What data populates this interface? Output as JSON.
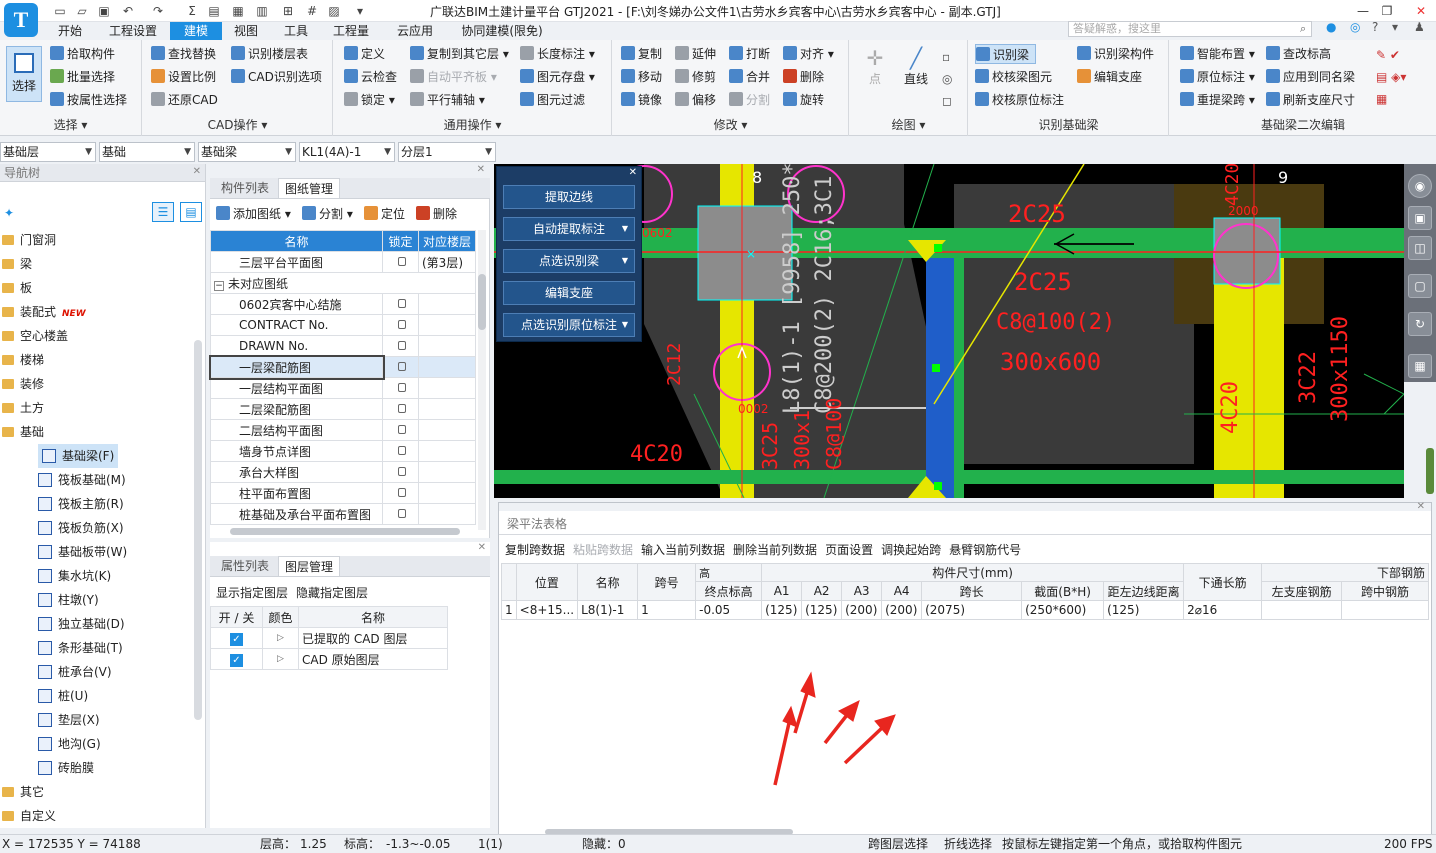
{
  "app": {
    "logo": "T",
    "title": "广联达BIM土建计量平台 GTJ2021 - [F:\\刘冬娣办公文件1\\古劳水乡宾客中心\\古劳水乡宾客中心 - 副本.GTJ]",
    "search_placeholder": "答疑解惑，搜这里"
  },
  "menu": [
    "开始",
    "工程设置",
    "建模",
    "视图",
    "工具",
    "工程量",
    "云应用",
    "协同建模(限免)"
  ],
  "ribbon": {
    "select": {
      "big": "选择",
      "items": [
        "拾取构件",
        "批量选择",
        "按属性选择"
      ],
      "label": "选择"
    },
    "cad": {
      "col1": [
        "查找替换",
        "设置比例",
        "还原CAD"
      ],
      "col2": [
        "识别楼层表",
        "CAD识别选项"
      ],
      "label": "CAD操作"
    },
    "common": {
      "col1": [
        "定义",
        "云检查",
        "锁定"
      ],
      "col2": [
        "复制到其它层",
        "自动平齐板",
        "平行辅轴"
      ],
      "col3": [
        "长度标注",
        "图元存盘",
        "图元过滤"
      ],
      "label": "通用操作"
    },
    "modify": {
      "col1": [
        "复制",
        "移动",
        "镜像"
      ],
      "col2": [
        "延伸",
        "修剪",
        "偏移"
      ],
      "col3": [
        "打断",
        "合并",
        "分割"
      ],
      "col4": [
        "对齐",
        "删除",
        "旋转"
      ],
      "label": "修改"
    },
    "draw": {
      "items": [
        "点",
        "直线"
      ],
      "label": "绘图"
    },
    "recog": {
      "items": [
        "识别梁",
        "校核梁图元",
        "校核原位标注"
      ],
      "col2": [
        "识别梁构件",
        "编辑支座"
      ],
      "label": "识别基础梁"
    },
    "second": {
      "col1": [
        "智能布置",
        "原位标注",
        "重提梁跨"
      ],
      "col2": [
        "查改标高",
        "应用到同名梁",
        "刷新支座尺寸"
      ],
      "label": "基础梁二次编辑"
    }
  },
  "selectors": [
    "基础层",
    "基础",
    "基础梁",
    "KL1(4A)-1",
    "分层1"
  ],
  "nav": {
    "title": "导航树",
    "items": [
      {
        "t": "门窗洞",
        "lvl": 0
      },
      {
        "t": "梁",
        "lvl": 0
      },
      {
        "t": "板",
        "lvl": 0
      },
      {
        "t": "装配式",
        "lvl": 0,
        "badge": "NEW"
      },
      {
        "t": "空心楼盖",
        "lvl": 0
      },
      {
        "t": "楼梯",
        "lvl": 0
      },
      {
        "t": "装修",
        "lvl": 0
      },
      {
        "t": "土方",
        "lvl": 0
      },
      {
        "t": "基础",
        "lvl": 0
      },
      {
        "t": "基础梁(F)",
        "lvl": 1,
        "sel": true
      },
      {
        "t": "筏板基础(M)",
        "lvl": 1
      },
      {
        "t": "筏板主筋(R)",
        "lvl": 1
      },
      {
        "t": "筏板负筋(X)",
        "lvl": 1
      },
      {
        "t": "基础板带(W)",
        "lvl": 1
      },
      {
        "t": "集水坑(K)",
        "lvl": 1
      },
      {
        "t": "柱墩(Y)",
        "lvl": 1
      },
      {
        "t": "独立基础(D)",
        "lvl": 1
      },
      {
        "t": "条形基础(T)",
        "lvl": 1
      },
      {
        "t": "桩承台(V)",
        "lvl": 1
      },
      {
        "t": "桩(U)",
        "lvl": 1
      },
      {
        "t": "垫层(X)",
        "lvl": 1
      },
      {
        "t": "地沟(G)",
        "lvl": 1
      },
      {
        "t": "砖胎膜",
        "lvl": 1
      },
      {
        "t": "其它",
        "lvl": 0
      },
      {
        "t": "自定义",
        "lvl": 0
      }
    ]
  },
  "comp": {
    "tabs": [
      "构件列表",
      "图纸管理"
    ],
    "toolbar": [
      "添加图纸",
      "分割",
      "定位",
      "删除"
    ],
    "cols": [
      "名称",
      "锁定",
      "对应楼层"
    ],
    "rows": [
      {
        "n": "三层平台平面图",
        "f": "(第3层)"
      },
      {
        "n": "未对应图纸",
        "group": true
      },
      {
        "n": "0602宾客中心结施"
      },
      {
        "n": "CONTRACT No."
      },
      {
        "n": "DRAWN No."
      },
      {
        "n": "一层梁配筋图",
        "sel": true
      },
      {
        "n": "一层结构平面图"
      },
      {
        "n": "二层梁配筋图"
      },
      {
        "n": "二层结构平面图"
      },
      {
        "n": "墙身节点详图"
      },
      {
        "n": "承台大样图"
      },
      {
        "n": "柱平面布置图"
      },
      {
        "n": "桩基础及承台平面布置图"
      }
    ]
  },
  "layer": {
    "tabs": [
      "属性列表",
      "图层管理"
    ],
    "toolbar": [
      "显示指定图层",
      "隐藏指定图层"
    ],
    "cols": [
      "开 / 关",
      "颜色",
      "名称"
    ],
    "rows": [
      "已提取的 CAD 图层",
      "CAD 原始图层"
    ]
  },
  "float_panel": [
    "提取边线",
    "自动提取标注",
    "点选识别梁",
    "编辑支座",
    "点选识别原位标注"
  ],
  "cad_text": {
    "axis8": "8",
    "axis9": "9",
    "beam_v": "L8(1)-1 [9958] 250*600",
    "beam_v2": "C8@200(2) 2C16;3C1",
    "t1": "2C25",
    "t2": "2C25",
    "t3": "C8@100(2)",
    "t4": "300x600",
    "t5": "4C20",
    "t6": "3C22",
    "t7": "300x1150",
    "t8": "2C12",
    "t9": "4C20",
    "t10": "3C25",
    "t11": "300x1",
    "t12": "C8@100",
    "t13": "0602",
    "t14": "0002",
    "t15": "2000",
    "t16": "4C20"
  },
  "beam": {
    "title": "梁平法表格",
    "toolbar": [
      "复制跨数据",
      "粘贴跨数据",
      "输入当前列数据",
      "删除当前列数据",
      "页面设置",
      "调换起始跨",
      "悬臂钢筋代号"
    ],
    "h1": [
      "位置",
      "名称",
      "跨号",
      "高",
      "构件尺寸(mm)",
      "下通长筋",
      "下部钢筋"
    ],
    "h2": [
      "终点标高",
      "A1",
      "A2",
      "A3",
      "A4",
      "跨长",
      "截面(B*H)",
      "距左边线距离",
      "左支座钢筋",
      "跨中钢筋"
    ],
    "row": [
      "1",
      "<8+15...",
      "L8(1)-1",
      "1",
      "-0.05",
      "(125)",
      "(125)",
      "(200)",
      "(200)",
      "(2075)",
      "(250*600)",
      "(125)",
      "2⌀16",
      "",
      ""
    ]
  },
  "status": {
    "coords": "X = 172535 Y = 74188",
    "floor_h": "层高：",
    "floor_v": "1.25",
    "elev": "标高：",
    "elev_v": "-1.3~-0.05",
    "count": "1(1)",
    "hidden": "隐藏：0",
    "hint1": "跨图层选择",
    "hint2": "折线选择",
    "hint3": "按鼠标左键指定第一个角点，或拾取构件图元",
    "fps": "200 FPS"
  },
  "colors": {
    "accent": "#1d8fe1",
    "cad_green": "#22b14c",
    "cad_yellow": "#e6e600",
    "cad_blue": "#1f5ec9",
    "cad_red": "#ff2020",
    "arrow": "#e8261f"
  }
}
